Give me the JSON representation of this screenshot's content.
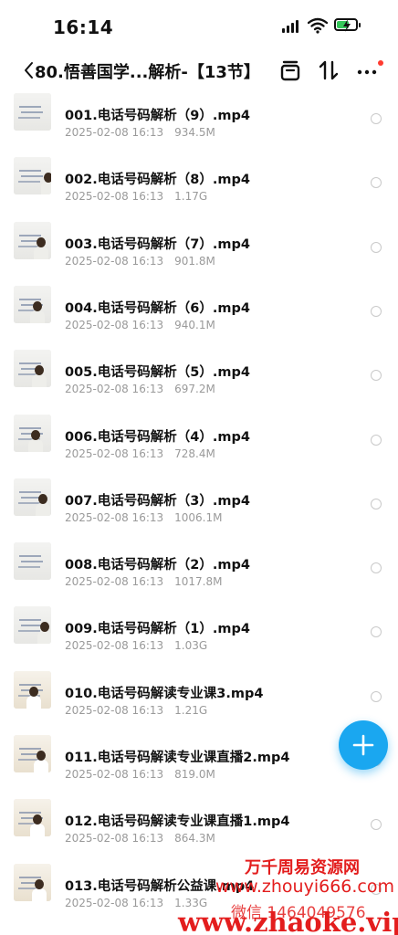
{
  "status_bar": {
    "time": "16:14"
  },
  "header": {
    "title": "80.悟善国学...解析-【13节】",
    "icons": [
      "back-icon",
      "select-icon",
      "sort-icon",
      "more-icon"
    ]
  },
  "files": [
    {
      "name": "001.电话号码解析（9）.mp4",
      "date": "2025-02-08 16:13",
      "size": "934.5M"
    },
    {
      "name": "002.电话号码解析（8）.mp4",
      "date": "2025-02-08 16:13",
      "size": "1.17G"
    },
    {
      "name": "003.电话号码解析（7）.mp4",
      "date": "2025-02-08 16:13",
      "size": "901.8M"
    },
    {
      "name": "004.电话号码解析（6）.mp4",
      "date": "2025-02-08 16:13",
      "size": "940.1M"
    },
    {
      "name": "005.电话号码解析（5）.mp4",
      "date": "2025-02-08 16:13",
      "size": "697.2M"
    },
    {
      "name": "006.电话号码解析（4）.mp4",
      "date": "2025-02-08 16:13",
      "size": "728.4M"
    },
    {
      "name": "007.电话号码解析（3）.mp4",
      "date": "2025-02-08 16:13",
      "size": "1006.1M"
    },
    {
      "name": "008.电话号码解析（2）.mp4",
      "date": "2025-02-08 16:13",
      "size": "1017.8M"
    },
    {
      "name": "009.电话号码解析（1）.mp4",
      "date": "2025-02-08 16:13",
      "size": "1.03G"
    },
    {
      "name": "010.电话号码解读专业课3.mp4",
      "date": "2025-02-08 16:13",
      "size": "1.21G"
    },
    {
      "name": "011.电话号码解读专业课直播2.mp4",
      "date": "2025-02-08 16:13",
      "size": "819.0M"
    },
    {
      "name": "012.电话号码解读专业课直播1.mp4",
      "date": "2025-02-08 16:13",
      "size": "864.3M"
    },
    {
      "name": "013.电话号码解析公益课.mp4",
      "date": "2025-02-08 16:13",
      "size": "1.33G"
    }
  ],
  "fab": {
    "icon": "plus-icon"
  },
  "watermark": {
    "line1": "万千周易资源网",
    "line2": "www.zhouyi666.com",
    "line3": "微信 1464049576",
    "line4": "www.zhaoke.vip"
  },
  "colors": {
    "accent": "#1aa7f0",
    "watermark": "#e31d1d",
    "meta_text": "#9a9a9a",
    "notify_dot": "#ff3b30",
    "battery": "#34c759"
  }
}
